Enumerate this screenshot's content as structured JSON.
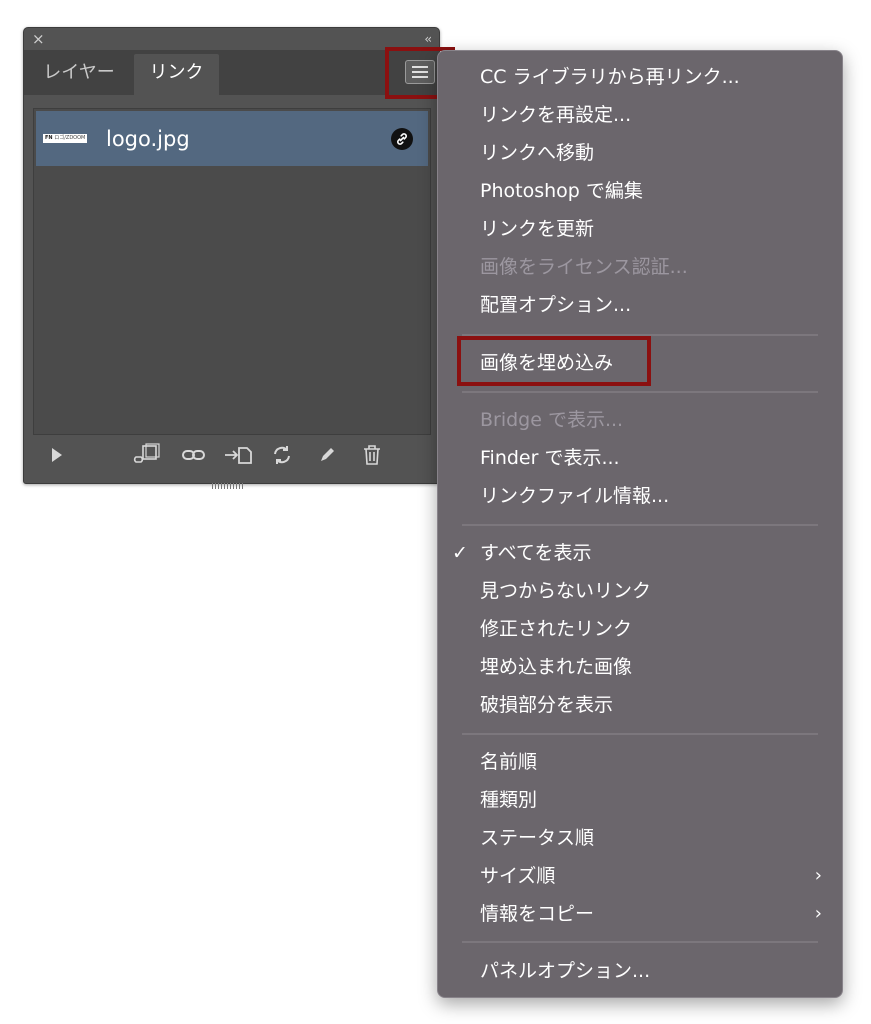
{
  "panel": {
    "close_glyph": "×",
    "collapse_glyph": "‹‹",
    "tabs": [
      {
        "label": "レイヤー"
      },
      {
        "label": "リンク"
      }
    ],
    "menu_button_icon": "hamburger-menu-icon",
    "links": [
      {
        "name": "logo.jpg",
        "status_icon": "chain-link-icon",
        "thumb_text": "FN",
        "thumb_sub": "ロゴ/ZDOOM"
      }
    ],
    "toolbar_icons": [
      "play-triangle-icon",
      "relink-cc-library-icon",
      "relink-icon",
      "goto-link-icon",
      "update-link-icon",
      "edit-original-icon",
      "trash-icon"
    ]
  },
  "menu": {
    "groups": [
      [
        {
          "label": "CC ライブラリから再リンク...",
          "enabled": true
        },
        {
          "label": "リンクを再設定...",
          "enabled": true
        },
        {
          "label": "リンクへ移動",
          "enabled": true
        },
        {
          "label": "Photoshop で編集",
          "enabled": true
        },
        {
          "label": "リンクを更新",
          "enabled": true
        },
        {
          "label": "画像をライセンス認証...",
          "enabled": false
        },
        {
          "label": "配置オプション...",
          "enabled": true
        }
      ],
      [
        {
          "label": "画像を埋め込み",
          "enabled": true,
          "highlighted": true
        }
      ],
      [
        {
          "label": "Bridge で表示...",
          "enabled": false
        },
        {
          "label": "Finder で表示...",
          "enabled": true
        },
        {
          "label": "リンクファイル情報...",
          "enabled": true
        }
      ],
      [
        {
          "label": "すべてを表示",
          "enabled": true,
          "checked": true
        },
        {
          "label": "見つからないリンク",
          "enabled": true
        },
        {
          "label": "修正されたリンク",
          "enabled": true
        },
        {
          "label": "埋め込まれた画像",
          "enabled": true
        },
        {
          "label": "破損部分を表示",
          "enabled": true
        }
      ],
      [
        {
          "label": "名前順",
          "enabled": true
        },
        {
          "label": "種類別",
          "enabled": true
        },
        {
          "label": "ステータス順",
          "enabled": true
        },
        {
          "label": "サイズ順",
          "enabled": true,
          "submenu": true
        },
        {
          "label": "情報をコピー",
          "enabled": true,
          "submenu": true
        }
      ],
      [
        {
          "label": "パネルオプション...",
          "enabled": true
        }
      ]
    ],
    "check_glyph": "✓",
    "submenu_glyph": "›"
  },
  "colors": {
    "panel_bg": "#535353",
    "selected_row": "#536880",
    "menu_bg": "#6b666c",
    "highlight_box": "#8b1010"
  }
}
